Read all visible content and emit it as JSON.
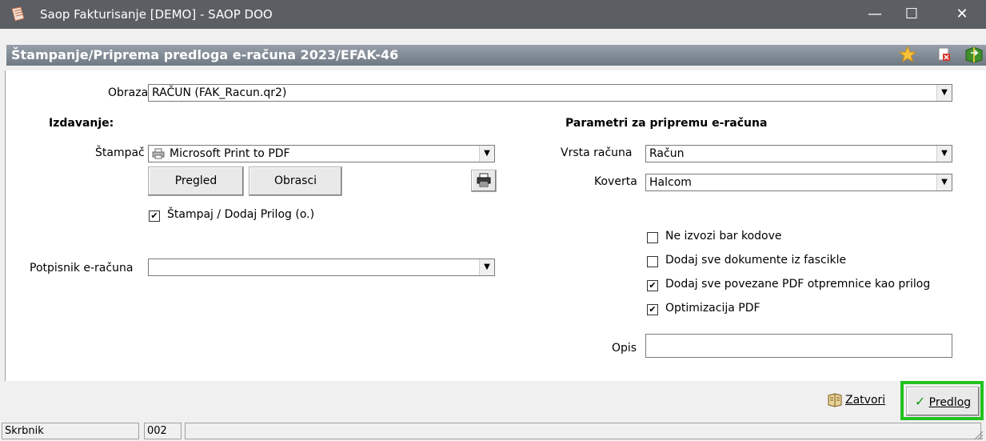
{
  "window": {
    "title": "Saop Fakturisanje [DEMO] - SAOP DOO",
    "minimize_label": "—",
    "maximize_label": "☐",
    "close_label": "✕"
  },
  "header": {
    "title": "Štampanje/Priprema predloga e-računa 2023/EFAK-46"
  },
  "form": {
    "obrazac_label": "Obrazac",
    "obrazac_value": "RAČUN  (FAK_Racun.qr2)",
    "izdavanje_heading": "Izdavanje:",
    "stampac_label": "Štampač",
    "stampac_value": "Microsoft Print to PDF",
    "pregled_label": "Pregled",
    "obrasci_label": "Obrasci",
    "stampaj_label": "Štampaj / Dodaj Prilog (o.)",
    "stampaj_checked": true,
    "potpisnik_label": "Potpisnik e-računa",
    "potpisnik_value": "",
    "parametri_heading": "Parametri za pripremu e-računa",
    "vrsta_label": "Vrsta računa",
    "vrsta_value": "Račun",
    "koverta_label": "Koverta",
    "koverta_value": "Halcom",
    "cb1_label": "Ne izvozi bar kodove",
    "cb1_checked": false,
    "cb2_label": "Dodaj sve dokumente iz fascikle",
    "cb2_checked": false,
    "cb3_label": "Dodaj sve povezane PDF otpremnice kao prilog",
    "cb3_checked": true,
    "cb4_label": "Optimizacija PDF",
    "cb4_checked": true,
    "opis_label": "Opis",
    "opis_value": ""
  },
  "actions": {
    "zatvori_label": "Zatvori",
    "predlog_label": "Predlog",
    "highlight_color": "#22c21f"
  },
  "status": {
    "user": "Skrbnik",
    "code": "002"
  },
  "colors": {
    "titlebar": "#5b5f63",
    "header_bar": "#7f8892"
  }
}
